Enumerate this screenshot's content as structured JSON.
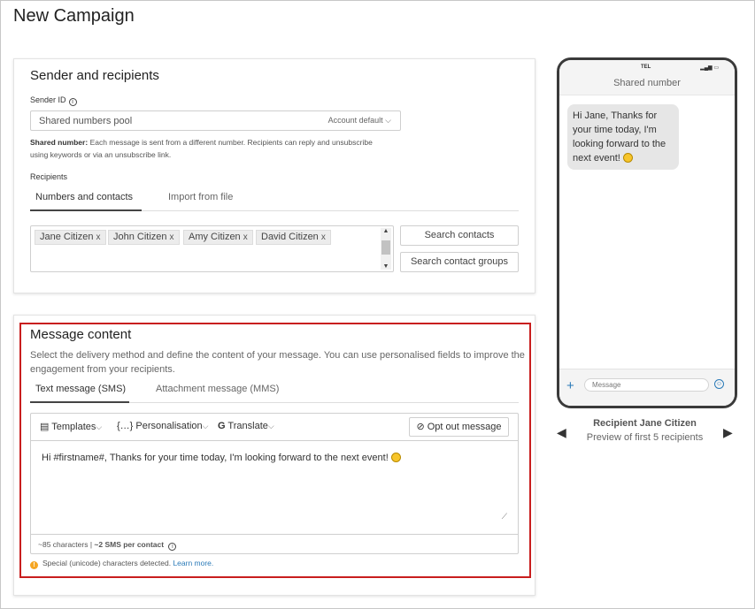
{
  "page_title": "New Campaign",
  "sender": {
    "title": "Sender and recipients",
    "sender_id_label": "Sender ID",
    "info_glyph": "i",
    "sender_value": "Shared numbers pool",
    "account_default": "Account default",
    "help_bold": "Shared number:",
    "help_text": "Each message is sent from a different number. Recipients can reply and unsubscribe using keywords or via an unsubscribe link.",
    "recipients_label": "Recipients",
    "tabs": [
      "Numbers and contacts",
      "Import from file"
    ],
    "active_tab": 0,
    "chips": [
      "Jane Citizen",
      "John Citizen",
      "Amy Citizen",
      "David Citizen"
    ],
    "chip_remove_glyph": "x",
    "search_contacts": "Search contacts",
    "search_groups": "Search contact groups"
  },
  "message": {
    "title": "Message content",
    "description": "Select the delivery method and define the content of your message. You can use personalised fields to improve the engagement from your recipients.",
    "tabs": [
      "Text message (SMS)",
      "Attachment message (MMS)"
    ],
    "active_tab": 0,
    "toolbar": {
      "templates": "Templates",
      "personalisation": "Personalisation",
      "translate": "Translate",
      "opt_out": "Opt out message"
    },
    "body": "Hi #firstname#, Thanks for your time today, I'm looking forward to the next event!",
    "counter_text": "~85 characters | ",
    "counter_bold": "~2 SMS per contact",
    "warning_text": "Special (unicode) characters detected.",
    "learn_more": "Learn more."
  },
  "preview": {
    "carrier": "TEL",
    "header": "Shared number",
    "bubble_text": "Hi Jane, Thanks for your time today, I'm looking forward to the next event!",
    "input_placeholder": "Message",
    "recipient_name": "Recipient Jane Citizen",
    "recipient_sub": "Preview of first 5 recipients"
  },
  "colors": {
    "accent": "#2a7ab8",
    "highlight_border": "#c81e1e",
    "warning": "#f5a623"
  }
}
